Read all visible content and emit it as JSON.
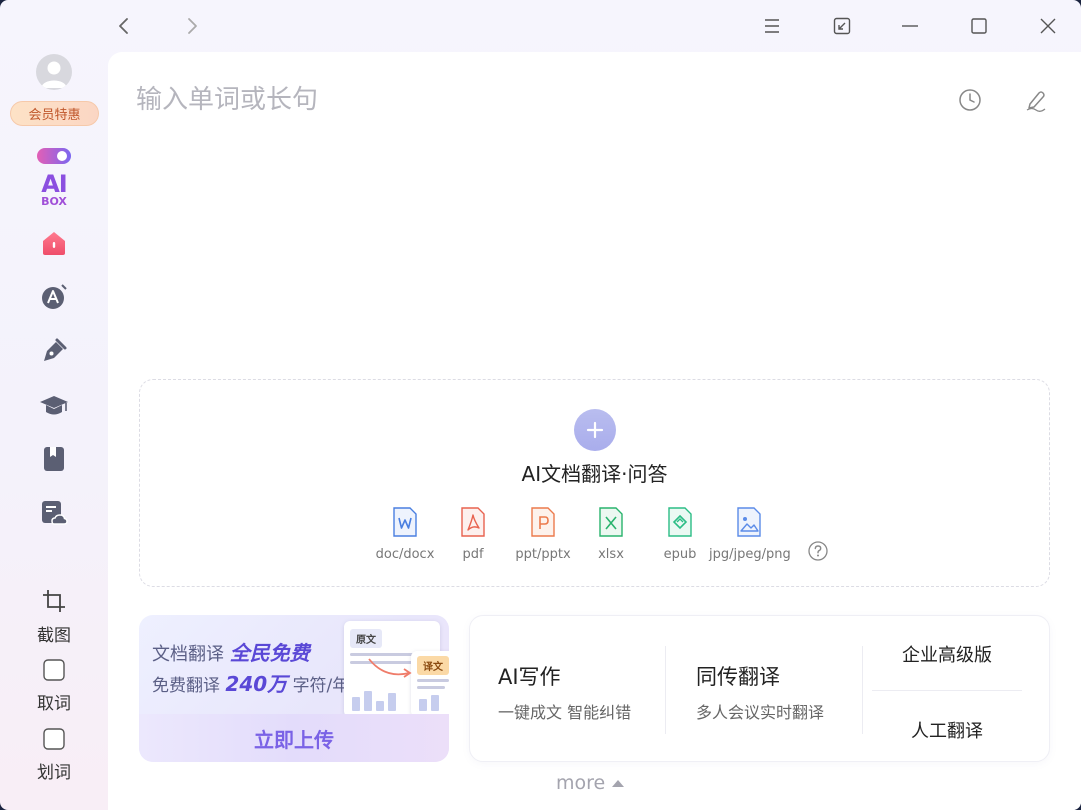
{
  "titlebar": {
    "back_icon": "chevron-left-icon",
    "forward_icon": "chevron-right-icon",
    "menu_icon": "hamburger-icon",
    "mini_icon": "compact-window-icon",
    "minimize_icon": "minimize-icon",
    "maximize_icon": "maximize-icon",
    "close_icon": "close-icon"
  },
  "sidebar": {
    "vip_label": "会员特惠",
    "aibox_ai": "AI",
    "aibox_box": "BOX",
    "nav_icons": [
      "home-icon",
      "translate-a-icon",
      "pen-icon",
      "graduation-cap-icon",
      "bookmark-book-icon",
      "document-cloud-icon"
    ],
    "tools": {
      "screenshot": "截图",
      "pick_word": "取词",
      "select_word": "划词"
    }
  },
  "search": {
    "placeholder": "输入单词或长句"
  },
  "dropzone": {
    "title": "AI文档翻译·问答",
    "file_types": [
      "doc/docx",
      "pdf",
      "ppt/pptx",
      "xlsx",
      "epub",
      "jpg/jpeg/png"
    ]
  },
  "promo": {
    "line1_prefix": "文档翻译",
    "line1_emph": "全民免费",
    "line2_prefix": "免费翻译",
    "line2_emph": "240万",
    "line2_suffix": "字符/年",
    "tag_source": "原文",
    "tag_target": "译文",
    "upload_button": "立即上传"
  },
  "features": {
    "ai_writing": {
      "title": "AI写作",
      "subtitle": "一键成文 智能纠错"
    },
    "simul_translate": {
      "title": "同传翻译",
      "subtitle": "多人会议实时翻译"
    },
    "enterprise": "企业高级版",
    "human_translate": "人工翻译"
  },
  "more_label": "more",
  "colors": {
    "accent": "#7a62e6",
    "word": "#4a7fe0",
    "pdf": "#e8624f",
    "ppt": "#ec7a4c",
    "xlsx": "#29b36d",
    "epub": "#2cbd86",
    "img": "#5b8be8"
  }
}
